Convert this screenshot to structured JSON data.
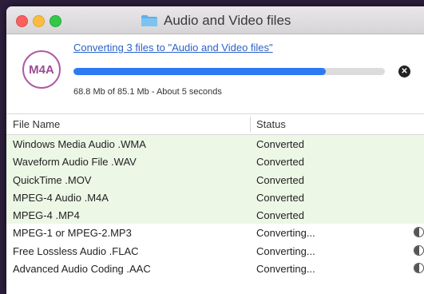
{
  "window": {
    "title": "Audio and Video files"
  },
  "converter": {
    "logo_text": "M4A",
    "headline": "Converting 3 files to \"Audio and Video files\"",
    "progress_fraction": 0.81,
    "progress_text": "68.8 Mb of 85.1 Mb - About 5 seconds"
  },
  "table": {
    "col_name": "File Name",
    "col_status": "Status",
    "rows": [
      {
        "name": "Windows Media Audio .WMA",
        "status": "Converted",
        "done": true
      },
      {
        "name": "Waveform Audio File .WAV",
        "status": "Converted",
        "done": true
      },
      {
        "name": "QuickTime .MOV",
        "status": "Converted",
        "done": true
      },
      {
        "name": "MPEG-4 Audio .M4A",
        "status": "Converted",
        "done": true
      },
      {
        "name": "MPEG-4 .MP4",
        "status": "Converted",
        "done": true
      },
      {
        "name": "MPEG-1 or MPEG-2.MP3",
        "status": "Converting...",
        "done": false
      },
      {
        "name": "Free Lossless Audio .FLAC",
        "status": "Converting...",
        "done": false
      },
      {
        "name": "Advanced Audio Coding .AAC",
        "status": "Converting...",
        "done": false
      }
    ]
  },
  "icons": {
    "folder": "folder-icon",
    "cancel": "close-icon",
    "converting": "progress-spinner-icon"
  },
  "colors": {
    "accent": "#2d7bf2",
    "logo": "#b15aa6",
    "done_row": "#edf7e6"
  }
}
